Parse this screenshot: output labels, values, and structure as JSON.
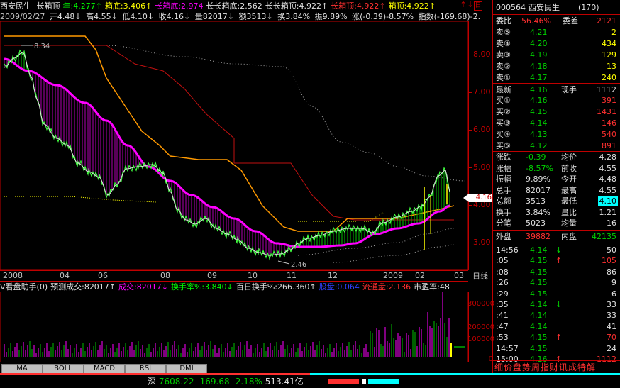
{
  "title_bar": {
    "stock_name": "西安民生",
    "items": [
      {
        "label": "长箱顶",
        "color": "#e0e0e0"
      },
      {
        "label": "年:4.277↑",
        "color": "#00ff00"
      },
      {
        "label": "箱底:3.406↑",
        "color": "#ffff00"
      },
      {
        "label": "长箱底:2.974",
        "color": "#ff00ff"
      },
      {
        "label": "长长箱底:2.562",
        "color": "#e0e0e0"
      },
      {
        "label": "长长箱顶:4.922↑",
        "color": "#e0e0e0"
      },
      {
        "label": "长箱顶:4.922↑",
        "color": "#ff3030"
      },
      {
        "label": "箱顶:4.922↑",
        "color": "#ffff00"
      }
    ],
    "icons": [
      "↑",
      "↓",
      "日"
    ]
  },
  "info_bar": {
    "date": "2009/02/27",
    "open": "开4.48↓",
    "high": "高4.55↓",
    "low": "低4.10↓",
    "close": "收4.16↓",
    "volume": "量82017↓",
    "amount": "额3513↓",
    "turnover": "换3.84%",
    "amplitude": "振9.89%",
    "change": "涨(-0.39)-8.57%",
    "index": "指数(-169.68)-2."
  },
  "main_chart_labels": {
    "high_marker": "8.34",
    "low_marker": "2.46",
    "current_price_tag": "4.16"
  },
  "price_axis": [
    "8.00",
    "7.00",
    "6.00",
    "5.00",
    "4.00",
    "3.00"
  ],
  "date_axis": [
    "2008",
    "04",
    "06",
    "08",
    "09",
    "10",
    "11",
    "12",
    "2009",
    "02",
    "03"
  ],
  "period_label": "日线",
  "volume_header": [
    {
      "label": "V看盘助手(0)",
      "color": "#e0e0e0"
    },
    {
      "label": "预测成交:82017↑",
      "color": "#e0e0e0"
    },
    {
      "label": "成交:82017↓",
      "color": "#ff00ff"
    },
    {
      "label": "换手率%:3.840↓",
      "color": "#00ff00"
    },
    {
      "label": "百日换手%:266.360↑",
      "color": "#e0e0e0"
    },
    {
      "label": "股盘:0.064",
      "color": "#3040ff"
    },
    {
      "label": "流通盘:2.136",
      "color": "#ff3030"
    },
    {
      "label": "市盈率:48",
      "color": "#e0e0e0"
    }
  ],
  "volume_axis": [
    "300000",
    "200000",
    "100000",
    "0"
  ],
  "tabs": [
    "MA",
    "BOLL",
    "MACD",
    "RSI",
    "DMI"
  ],
  "status_bar": {
    "market": "深",
    "value": "7608.22",
    "change": "-169.68",
    "percent": "-2.18%",
    "amount": "513.41亿"
  },
  "right_panel": {
    "code": "000564",
    "name": "西安民生",
    "count": "(170)",
    "weibi_label": "委比",
    "weibi": "56.46%",
    "weicha_label": "委差",
    "weicha": "2121",
    "sells": [
      {
        "label": "卖⑤",
        "price": "4.21",
        "vol": "2"
      },
      {
        "label": "卖④",
        "price": "4.20",
        "vol": "434"
      },
      {
        "label": "卖③",
        "price": "4.19",
        "vol": "129"
      },
      {
        "label": "卖②",
        "price": "4.18",
        "vol": "13"
      },
      {
        "label": "卖①",
        "price": "4.17",
        "vol": "240"
      }
    ],
    "latest_label": "最新",
    "latest": "4.16",
    "xianshou_label": "现手",
    "xianshou": "1112",
    "buys": [
      {
        "label": "买①",
        "price": "4.16",
        "vol": "391"
      },
      {
        "label": "买②",
        "price": "4.15",
        "vol": "1431"
      },
      {
        "label": "买③",
        "price": "4.14",
        "vol": "146"
      },
      {
        "label": "买④",
        "price": "4.13",
        "vol": "540"
      },
      {
        "label": "买⑤",
        "price": "4.12",
        "vol": "891"
      }
    ],
    "stats": [
      {
        "l1": "涨跌",
        "v1": "-0.39",
        "l2": "均价",
        "v2": "4.28"
      },
      {
        "l1": "涨幅",
        "v1": "-8.57%",
        "l2": "前收",
        "v2": "4.55"
      },
      {
        "l1": "振幅",
        "v1": "9.89%",
        "l2": "今开",
        "v2": "4.48"
      },
      {
        "l1": "总手",
        "v1": "82017",
        "l2": "最高",
        "v2": "4.55"
      },
      {
        "l1": "总额",
        "v1": "3513",
        "l2": "最低",
        "v2": "4.10"
      },
      {
        "l1": "换手",
        "v1": "3.84%",
        "l2": "量比",
        "v2": "1.21"
      },
      {
        "l1": "分笔",
        "v1": "5023",
        "l2": "均量",
        "v2": "16"
      }
    ],
    "waipan_label": "外盘",
    "waipan": "39882",
    "neipan_label": "内盘",
    "neipan": "42135",
    "ticks": [
      {
        "time": "14:56",
        "price": "4.14",
        "dir": "↓",
        "vol": "50"
      },
      {
        "time": ":05",
        "price": "4.15",
        "dir": "↑",
        "vol": "105"
      },
      {
        "time": ":08",
        "price": "4.15",
        "dir": "",
        "vol": "86"
      },
      {
        "time": ":26",
        "price": "4.15",
        "dir": "",
        "vol": "9"
      },
      {
        "time": ":29",
        "price": "4.15",
        "dir": "",
        "vol": "6"
      },
      {
        "time": ":35",
        "price": "4.14",
        "dir": "↓",
        "vol": "33"
      },
      {
        "time": ":41",
        "price": "4.14",
        "dir": "",
        "vol": "33"
      },
      {
        "time": ":47",
        "price": "4.14",
        "dir": "",
        "vol": "41"
      },
      {
        "time": ":53",
        "price": "4.15",
        "dir": "↑",
        "vol": "70"
      },
      {
        "time": "14:57",
        "price": "4.15",
        "dir": "",
        "vol": "24"
      },
      {
        "time": "15:00",
        "price": "4.16",
        "dir": "↑",
        "vol": "1112"
      }
    ],
    "footer": "细价盘势周指财讯成特解"
  }
}
